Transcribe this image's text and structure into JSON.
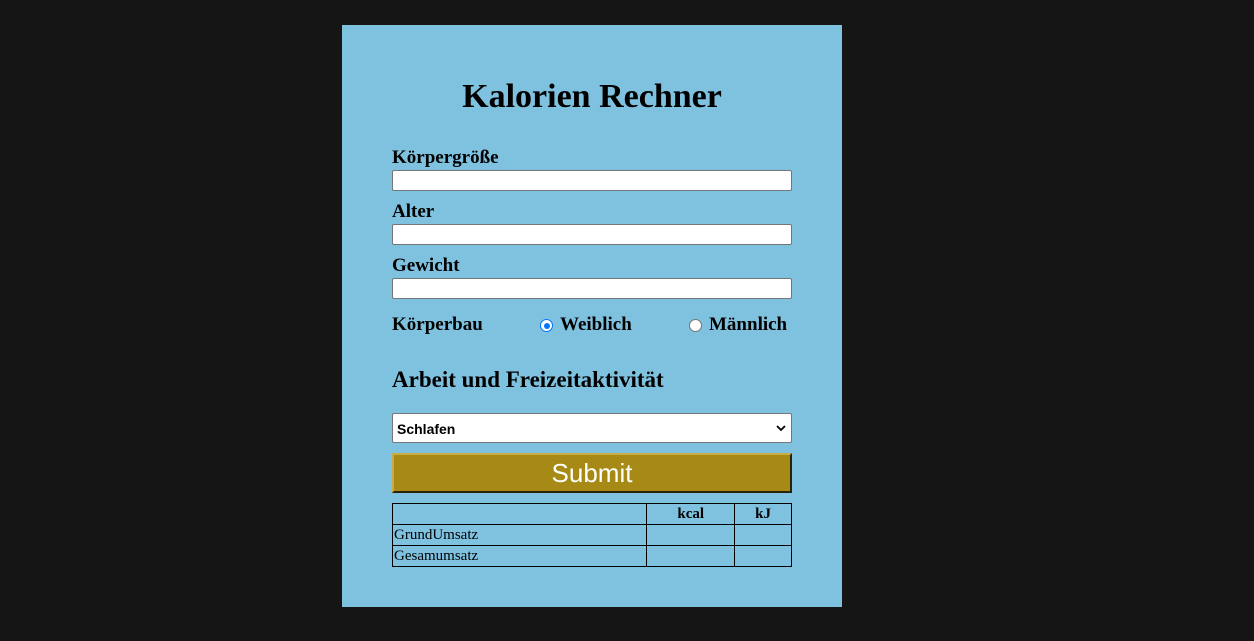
{
  "form": {
    "title": "Kalorien Rechner",
    "fields": [
      {
        "label": "Körpergröße",
        "value": ""
      },
      {
        "label": "Alter",
        "value": ""
      },
      {
        "label": "Gewicht",
        "value": ""
      }
    ],
    "body_type": {
      "label": "Körperbau",
      "options": [
        {
          "label": "Weiblich",
          "checked": true
        },
        {
          "label": "Männlich",
          "checked": false
        }
      ]
    },
    "activity": {
      "heading": "Arbeit und Freizeitaktivität",
      "selected": "Schlafen"
    },
    "submit_label": "Submit"
  },
  "results": {
    "headers": [
      "",
      "kcal",
      "kJ"
    ],
    "rows": [
      {
        "label": "GrundUmsatz",
        "kcal": "",
        "kj": ""
      },
      {
        "label": "Gesamumsatz",
        "kcal": "",
        "kj": ""
      }
    ]
  },
  "colors": {
    "page_background": "#151515",
    "card_background": "#7fc2e0",
    "submit_background": "#a68a15",
    "radio_accent": "#0075ff"
  }
}
